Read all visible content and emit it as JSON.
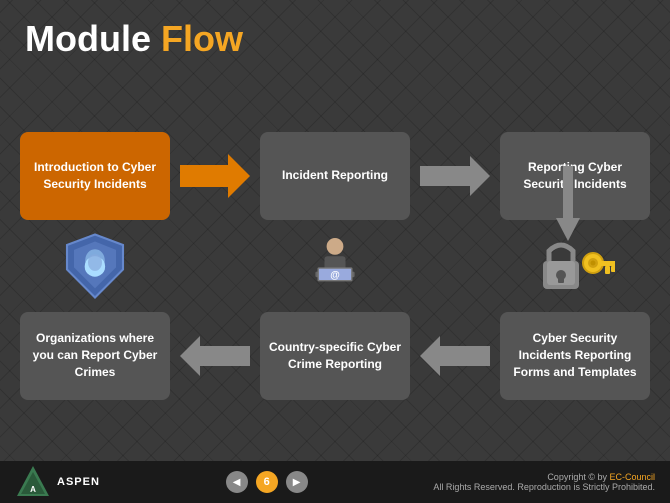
{
  "slide": {
    "title": {
      "module": "Module ",
      "flow": "Flow"
    },
    "boxes": {
      "intro": "Introduction to Cyber Security Incidents",
      "incident_reporting": "Incident Reporting",
      "reporting_cyber": "Reporting Cyber Security Incidents",
      "organizations": "Organizations where you can Report Cyber Crimes",
      "country_specific": "Country-specific Cyber Crime Reporting",
      "cyber_security_forms": "Cyber Security Incidents Reporting Forms and Templates"
    },
    "footer": {
      "logo_text": "ASPEN",
      "page_number": "6",
      "copyright": "Copyright © by EC-Council",
      "rights": "All Rights Reserved. Reproduction is Strictly Prohibited."
    }
  }
}
